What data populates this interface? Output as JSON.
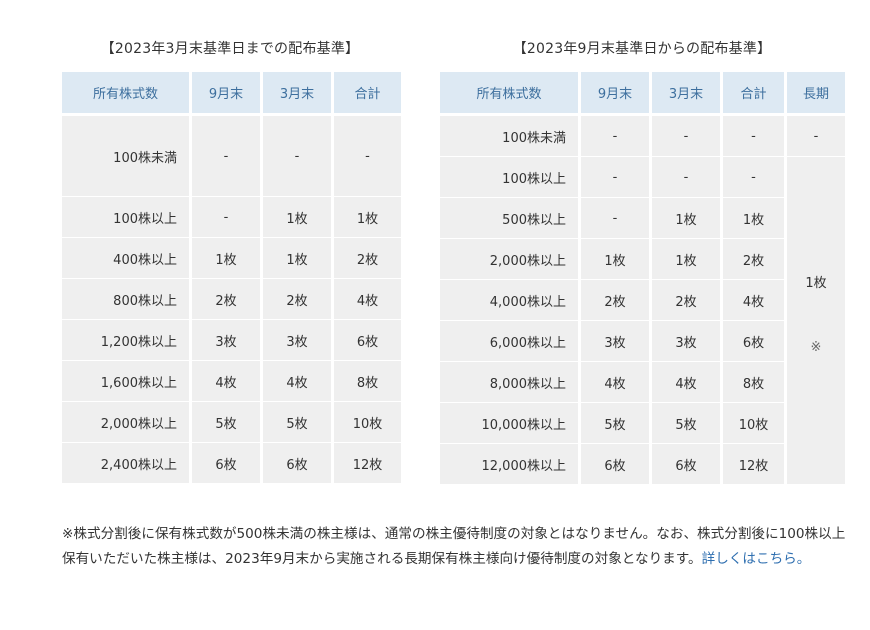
{
  "table1": {
    "caption": "【2023年3月末基準日までの配布基準】",
    "headers": [
      "所有株式数",
      "9月末",
      "3月末",
      "合計"
    ],
    "rows": [
      [
        "100株未満",
        "-",
        "-",
        "-"
      ],
      [
        "100株以上",
        "-",
        "1枚",
        "1枚"
      ],
      [
        "400株以上",
        "1枚",
        "1枚",
        "2枚"
      ],
      [
        "800株以上",
        "2枚",
        "2枚",
        "4枚"
      ],
      [
        "1,200株以上",
        "3枚",
        "3枚",
        "6枚"
      ],
      [
        "1,600株以上",
        "4枚",
        "4枚",
        "8枚"
      ],
      [
        "2,000株以上",
        "5枚",
        "5枚",
        "10枚"
      ],
      [
        "2,400株以上",
        "6枚",
        "6枚",
        "12枚"
      ]
    ]
  },
  "table2": {
    "caption": "【2023年9月末基準日からの配布基準】",
    "headers": [
      "所有株式数",
      "9月末",
      "3月末",
      "合計",
      "長期"
    ],
    "rows": [
      [
        "100株未満",
        "-",
        "-",
        "-"
      ],
      [
        "100株以上",
        "-",
        "-",
        "-"
      ],
      [
        "500株以上",
        "-",
        "1枚",
        "1枚"
      ],
      [
        "2,000株以上",
        "1枚",
        "1枚",
        "2枚"
      ],
      [
        "4,000株以上",
        "2枚",
        "2枚",
        "4枚"
      ],
      [
        "6,000株以上",
        "3枚",
        "3枚",
        "6枚"
      ],
      [
        "8,000株以上",
        "4枚",
        "4枚",
        "8枚"
      ],
      [
        "10,000株以上",
        "5枚",
        "5枚",
        "10枚"
      ],
      [
        "12,000株以上",
        "6枚",
        "6枚",
        "12枚"
      ]
    ],
    "long_first": "-",
    "long_value": "1枚",
    "long_mark": "※"
  },
  "note": {
    "text": "※株式分割後に保有株式数が500株未満の株主様は、通常の株主優待制度の対象とはなりません。なお、株式分割後に100株以上保有いただいた株主様は、2023年9月末から実施される長期保有株主様向け優待制度の対象となります。",
    "link": "詳しくはこちら。"
  }
}
